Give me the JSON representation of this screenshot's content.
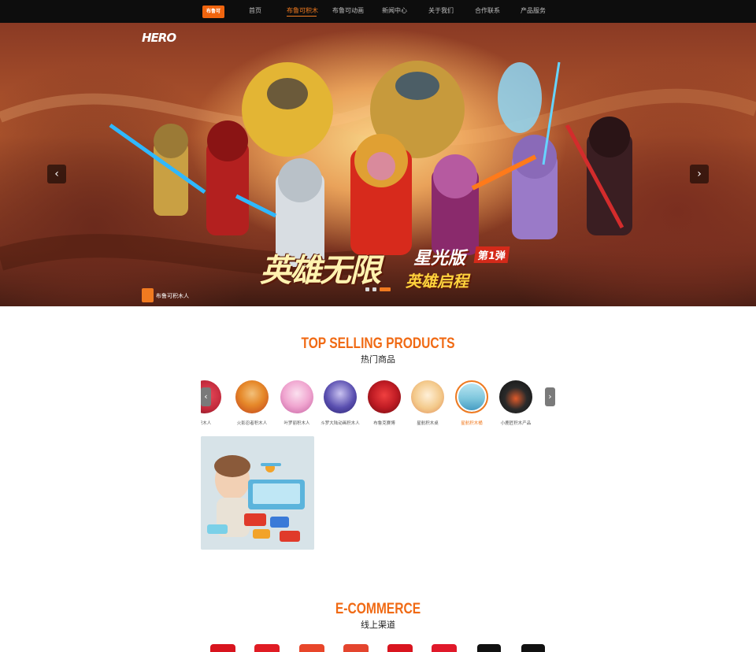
{
  "nav": {
    "logo_text": "布鲁可",
    "items": [
      {
        "label": "首页",
        "active": false
      },
      {
        "label": "布鲁可积木",
        "active": true
      },
      {
        "label": "布鲁可动画",
        "active": false
      },
      {
        "label": "新闻中心",
        "active": false
      },
      {
        "label": "关于我们",
        "active": false
      },
      {
        "label": "合作联系",
        "active": false
      },
      {
        "label": "产品服务",
        "active": false
      }
    ]
  },
  "banner": {
    "brand": "HERO",
    "title": "英雄无限",
    "subtitle": "星光版",
    "badge": "第1弹",
    "slogan": "英雄启程",
    "footer_text": "布鲁可积木人",
    "prev_icon": "chevron-left-icon",
    "next_icon": "chevron-right-icon",
    "slide_count": 3,
    "active_slide": 3
  },
  "top_selling": {
    "title": "TOP SELLING PRODUCTS",
    "subtitle": "热门商品",
    "products": [
      {
        "label": "积木人",
        "color": "#c0283a",
        "active": false
      },
      {
        "label": "火影忍者积木人",
        "color": "#e6892a",
        "active": false
      },
      {
        "label": "叶罗丽积木人",
        "color": "#f0a6d0",
        "active": false
      },
      {
        "label": "斗罗大陆动画积木人",
        "color": "#5a4fb0",
        "active": false
      },
      {
        "label": "布鲁克赛博",
        "color": "#c01c24",
        "active": false
      },
      {
        "label": "星航积木桌",
        "color": "#f3c98a",
        "active": false
      },
      {
        "label": "星航积木桶",
        "color": "#7fc7dd",
        "active": true
      },
      {
        "label": "小鹿匠积木产品",
        "color": "#2a2a2a",
        "active": false
      }
    ],
    "prev_icon": "chevron-left-icon",
    "next_icon": "chevron-right-icon"
  },
  "ecommerce": {
    "title": "E-COMMERCE",
    "subtitle": "线上渠道",
    "channels": [
      {
        "icon": "tmall-icon",
        "color": "#d8141e"
      },
      {
        "icon": "jd-icon",
        "color": "#e01c24"
      },
      {
        "icon": "taobao-icon",
        "color": "#e8462a"
      },
      {
        "icon": "store-icon",
        "color": "#e4452e"
      },
      {
        "icon": "pinduoduo-icon",
        "color": "#d9151f"
      },
      {
        "icon": "shop-icon",
        "color": "#e0192a"
      },
      {
        "icon": "douyin-icon",
        "color": "#111111"
      },
      {
        "icon": "kuaishou-icon",
        "color": "#111111"
      }
    ]
  }
}
